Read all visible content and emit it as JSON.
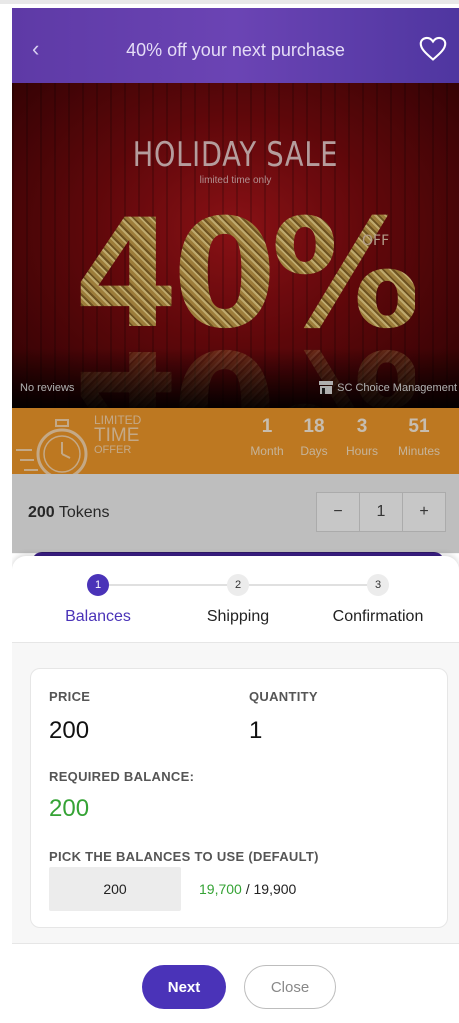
{
  "header": {
    "title": "40% off your next purchase",
    "back_icon": "chevron-left-icon",
    "favorite_icon": "heart-outline-icon"
  },
  "banner": {
    "headline": "HOLIDAY SALE",
    "subheadline": "limited time only",
    "percent": "40%",
    "off_text": "OFF",
    "reviews_text": "No reviews",
    "vendor": "SC Choice Management",
    "vendor_icon": "store-icon"
  },
  "limited_offer": {
    "line1": "LIMITED",
    "line2": "TIME",
    "line3": "OFFER",
    "icon": "stopwatch-icon",
    "countdown": [
      {
        "value": "1",
        "unit": "Month"
      },
      {
        "value": "18",
        "unit": "Days"
      },
      {
        "value": "3",
        "unit": "Hours"
      },
      {
        "value": "51",
        "unit": "Minutes"
      }
    ]
  },
  "product": {
    "token_amount": "200",
    "token_suffix": " Tokens",
    "minus": "−",
    "quantity": "1",
    "plus": "+"
  },
  "stepper": {
    "steps": [
      {
        "number": "1",
        "label": "Balances",
        "active": true
      },
      {
        "number": "2",
        "label": "Shipping",
        "active": false
      },
      {
        "number": "3",
        "label": "Confirmation",
        "active": false
      }
    ]
  },
  "summary": {
    "price_label": "PRICE",
    "price_value": "200",
    "quantity_label": "QUANTITY",
    "quantity_value": "1",
    "required_label": "REQUIRED BALANCE:",
    "required_value": "200",
    "pick_label": "PICK THE BALANCES TO USE (DEFAULT)",
    "balance_input": "200",
    "balance_remaining": "19,700",
    "balance_separator": " / ",
    "balance_total": "19,900"
  },
  "actions": {
    "next_label": "Next",
    "close_label": "Close"
  },
  "colors": {
    "accent": "#4a33b8",
    "header": "#5e3aa6",
    "offer_bar": "#f39a2b",
    "success": "#35a335"
  }
}
